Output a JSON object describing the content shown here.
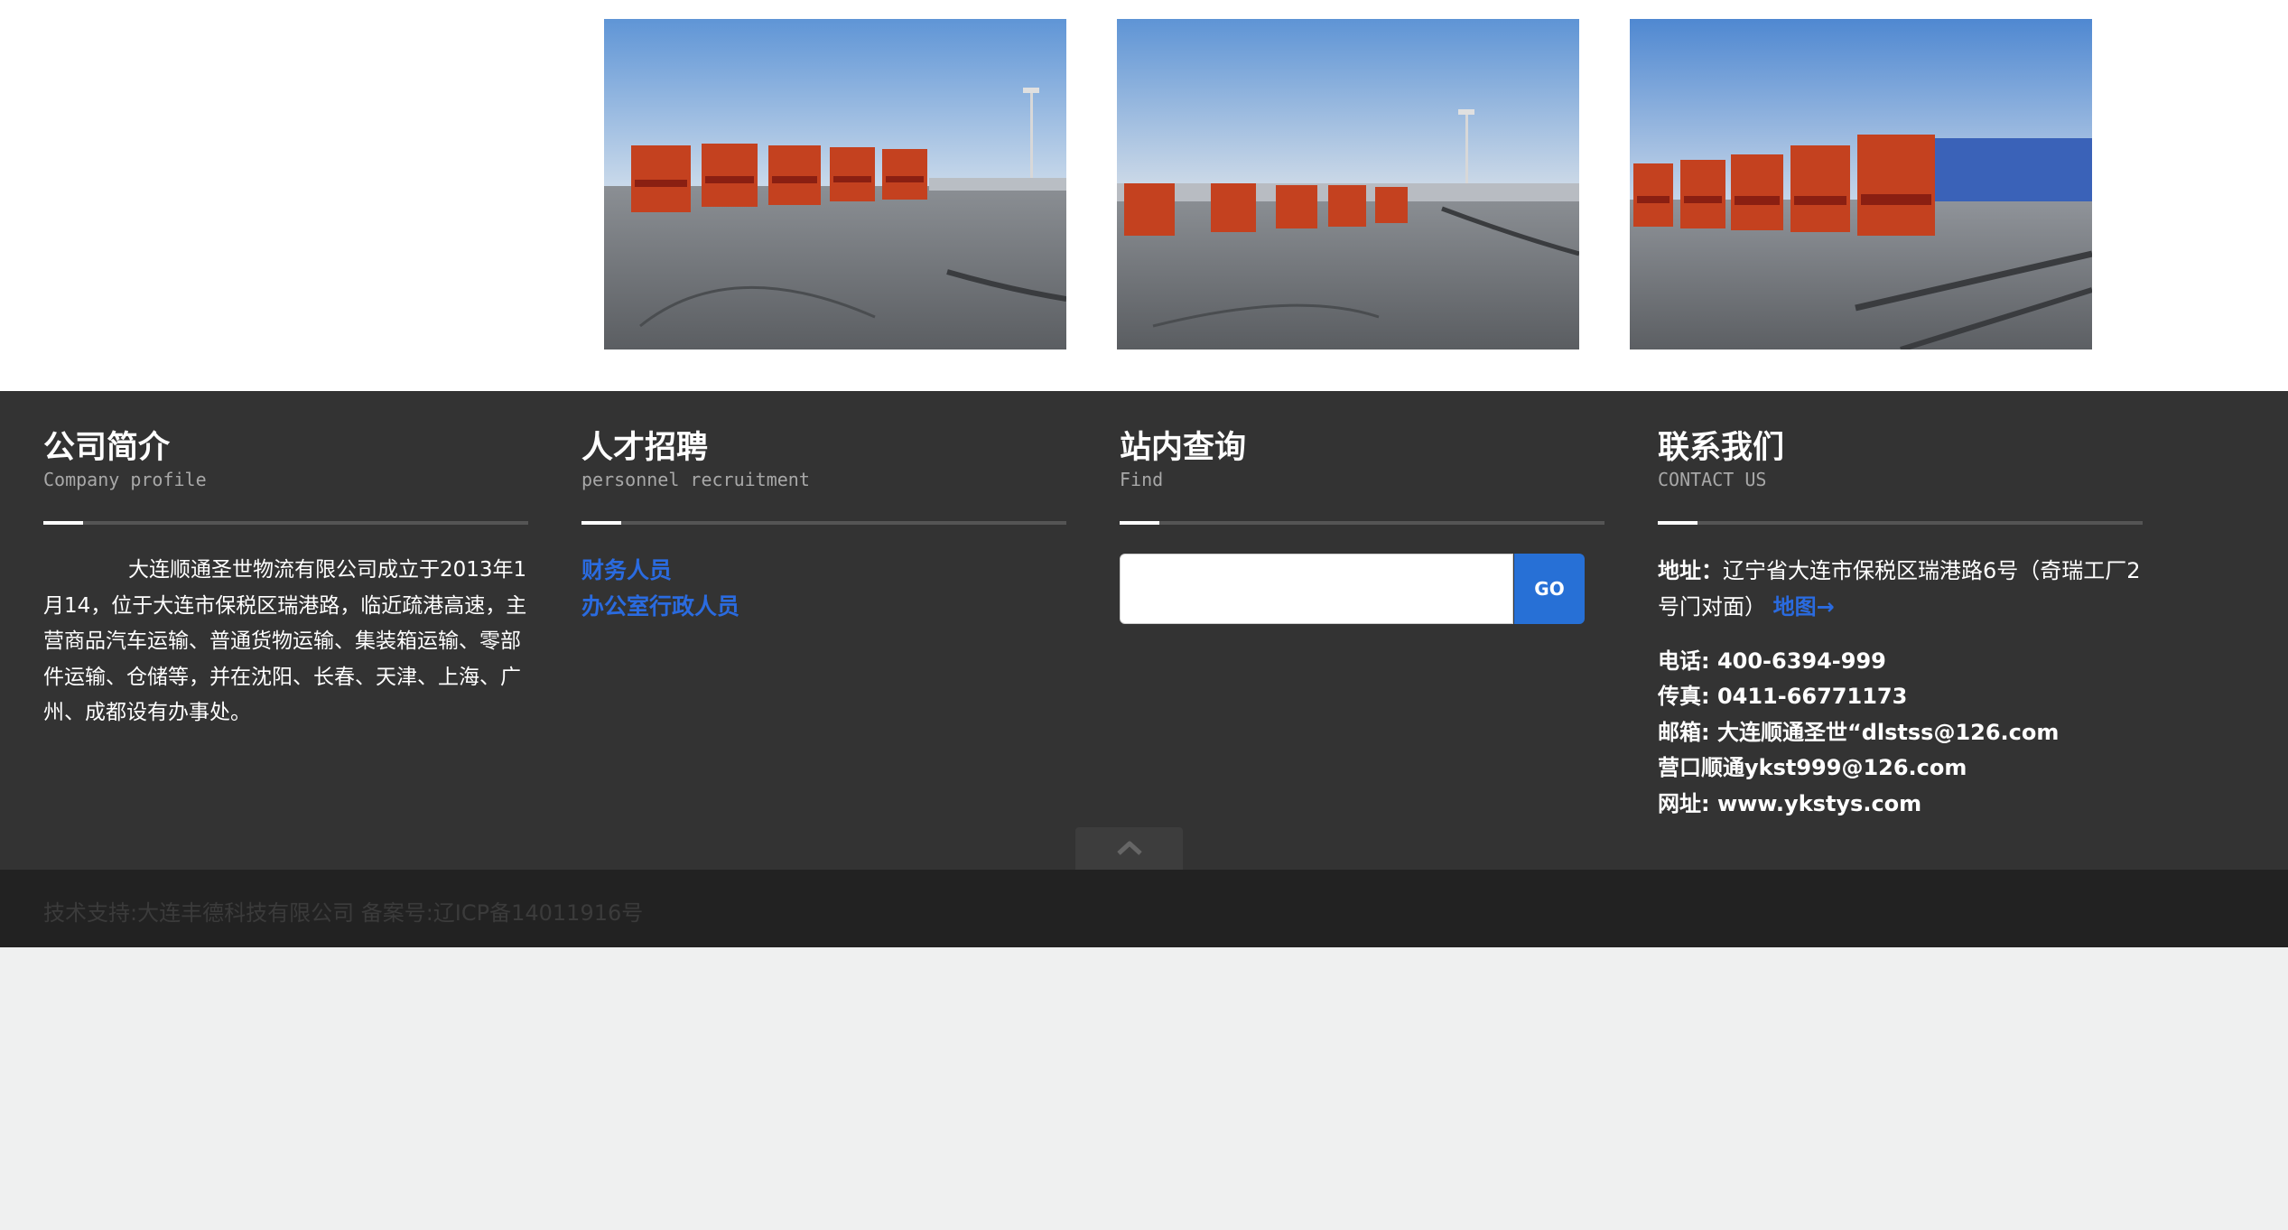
{
  "gallery": {
    "photos": [
      {
        "icon": "truck-fleet-photo-1"
      },
      {
        "icon": "truck-fleet-photo-2"
      },
      {
        "icon": "truck-fleet-photo-3"
      }
    ]
  },
  "footer": {
    "about": {
      "title": "公司简介",
      "subtitle": "Company profile",
      "text": "大连顺通圣世物流有限公司成立于2013年1月14，位于大连市保税区瑞港路，临近疏港高速，主营商品汽车运输、普通货物运输、集装箱运输、零部件运输、仓储等，并在沈阳、长春、天津、上海、广州、成都设有办事处。"
    },
    "recruit": {
      "title": "人才招聘",
      "subtitle": "personnel recruitment",
      "links": [
        "财务人员",
        "办公室行政人员"
      ]
    },
    "search": {
      "title": "站内查询",
      "subtitle": "Find",
      "placeholder": "",
      "button": "GO"
    },
    "contact": {
      "title": "联系我们",
      "subtitle": "CONTACT US",
      "address_label": "地址：",
      "address": "辽宁省大连市保税区瑞港路6号（奇瑞工厂2号门对面）",
      "map_link": "地图→",
      "lines": [
        "电话: 400-6394-999",
        "传真: 0411-66771173",
        "邮箱: 大连顺通圣世“dlstss@126.com",
        "营口顺通ykst999@126.com",
        "网址: www.ykstys.com"
      ]
    }
  },
  "back_to_top": {
    "icon": "chevron-up-icon"
  },
  "copyright": {
    "text": "技术支持:大连丰德科技有限公司 备案号:辽ICP备14011916号"
  },
  "colors": {
    "footer_bg": "#333333",
    "copyright_bg": "#222222",
    "accent": "#2a6be0",
    "button": "#2770d6",
    "page_bg": "#eff0f0"
  }
}
